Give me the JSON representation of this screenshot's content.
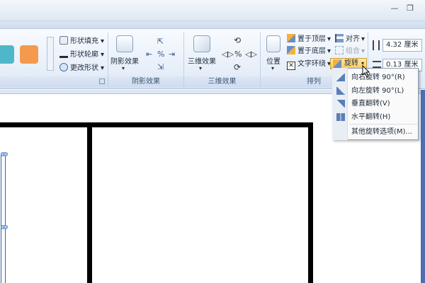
{
  "ribbon": {
    "shape_styles": {
      "shape_fill": "形状填充",
      "shape_outline": "形状轮廓",
      "change_shape": "更改形状"
    },
    "shadow": {
      "shadow_effects": "阴影效果",
      "group_label": "阴影效果"
    },
    "three_d": {
      "three_d_effects": "三维效果",
      "group_label": "三维效果"
    },
    "arrange": {
      "position": "位置",
      "bring_to_front": "置于顶层",
      "send_to_back": "置于底层",
      "text_wrapping": "文字环绕",
      "align": "对齐",
      "group": "组合",
      "rotate": "旋转",
      "group_label": "排列"
    },
    "size": {
      "height_value": "4.32 厘米",
      "width_value": "0.13 厘米"
    }
  },
  "rotate_menu": {
    "items": [
      {
        "label": "向右旋转 90°(R)"
      },
      {
        "label": "向左旋转 90°(L)"
      },
      {
        "label": "垂直翻转(V)"
      },
      {
        "label": "水平翻转(H)"
      },
      {
        "label": "其他旋转选项(M)..."
      }
    ]
  },
  "colors": {
    "swatch_teal": "#4fb7c9",
    "swatch_orange": "#f49a4f",
    "accent_highlight": "#ffc958"
  }
}
